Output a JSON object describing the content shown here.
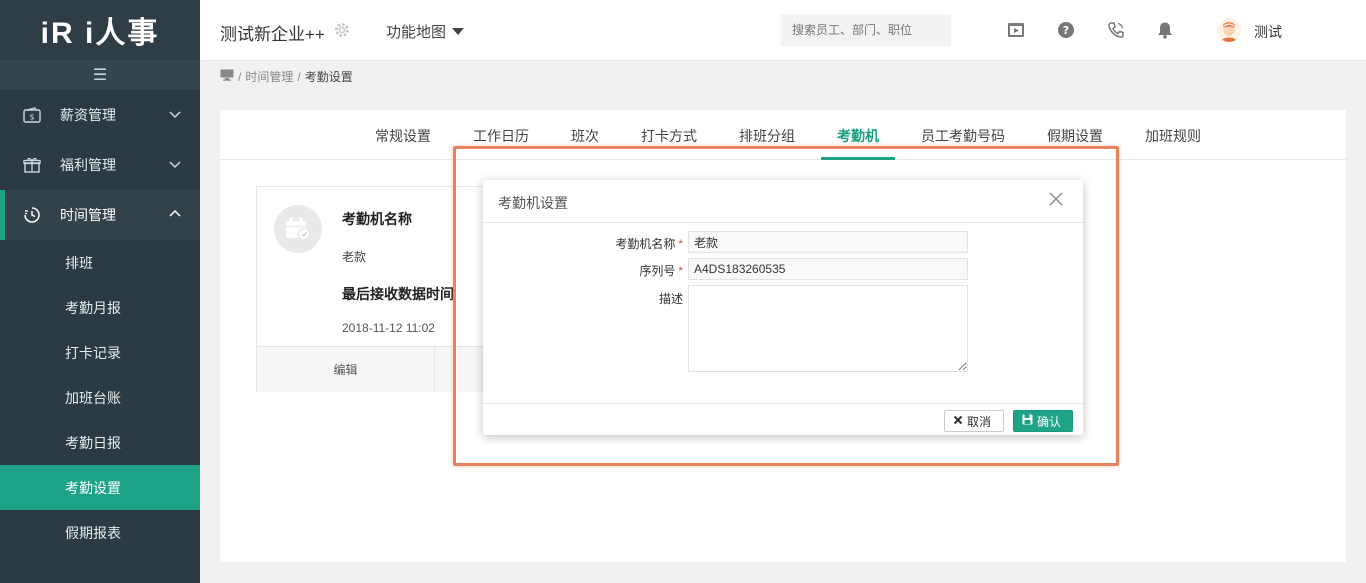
{
  "app": {
    "logo_text": "iR i人事"
  },
  "sidebar": {
    "menu_icon": "hamburger-icon",
    "groups": [
      {
        "label": "薪资管理",
        "icon": "wallet-icon",
        "expanded": false
      },
      {
        "label": "福利管理",
        "icon": "gift-icon",
        "expanded": false
      },
      {
        "label": "时间管理",
        "icon": "clock-icon",
        "expanded": true
      }
    ],
    "sub_items": [
      {
        "label": "排班"
      },
      {
        "label": "考勤月报"
      },
      {
        "label": "打卡记录"
      },
      {
        "label": "加班台账"
      },
      {
        "label": "考勤日报"
      },
      {
        "label": "考勤设置",
        "active": true
      },
      {
        "label": "假期报表"
      }
    ]
  },
  "header": {
    "company": "测试新企业++",
    "func_map": "功能地图",
    "search_placeholder": "搜索员工、部门、职位",
    "icons": [
      "video-icon",
      "help-icon",
      "phone-icon",
      "bell-icon"
    ],
    "username": "测试"
  },
  "breadcrumb": {
    "home_icon": "monitor-icon",
    "parent": "时间管理",
    "current": "考勤设置"
  },
  "tabs": [
    {
      "label": "常规设置"
    },
    {
      "label": "工作日历"
    },
    {
      "label": "班次"
    },
    {
      "label": "打卡方式"
    },
    {
      "label": "排班分组"
    },
    {
      "label": "考勤机",
      "active": true
    },
    {
      "label": "员工考勤号码"
    },
    {
      "label": "假期设置"
    },
    {
      "label": "加班规则"
    }
  ],
  "card": {
    "title": "考勤机名称",
    "name": "老款",
    "last_label": "最后接收数据时间",
    "last_time": "2018-11-12 11:02",
    "edit_label": "编辑"
  },
  "modal": {
    "title": "考勤机设置",
    "fields": {
      "name_label": "考勤机名称",
      "name_value": "老款",
      "serial_label": "序列号",
      "serial_value": "A4DS183260535",
      "desc_label": "描述",
      "desc_value": "",
      "required_mark": "*"
    },
    "cancel_label": "取消",
    "ok_label": "确认"
  },
  "colors": {
    "accent": "#1fa387",
    "sidebar_bg": "#2b3a42",
    "highlight": "#e8825e",
    "required": "#d9534f"
  }
}
